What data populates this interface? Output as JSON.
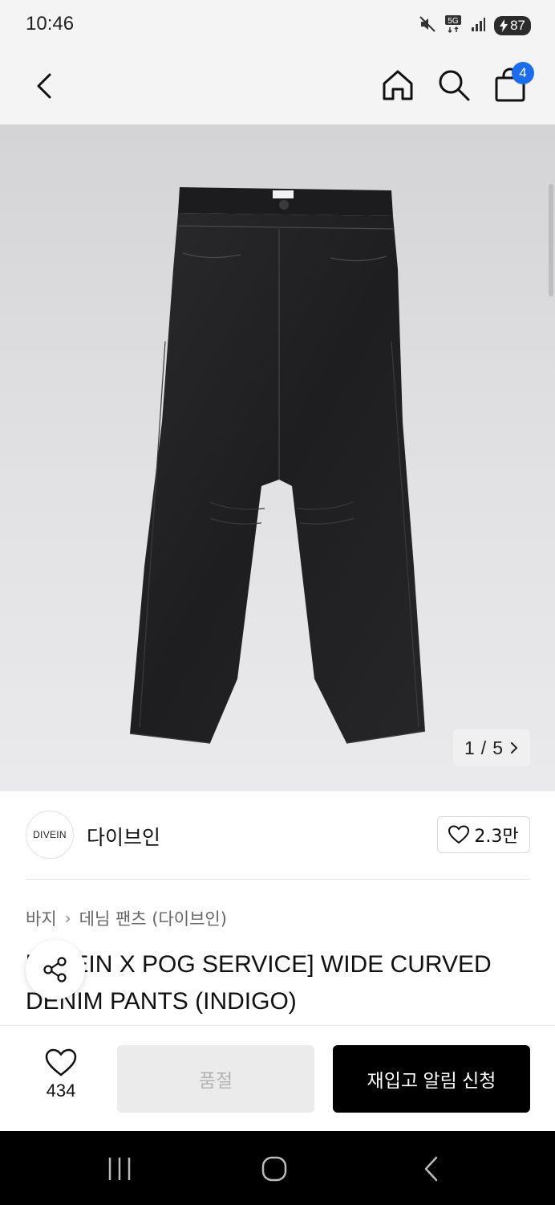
{
  "status_bar": {
    "time": "10:46",
    "battery": "87",
    "icons": [
      "mute-icon",
      "5g-icon",
      "signal-icon",
      "battery-icon"
    ]
  },
  "header": {
    "icons": [
      "back-icon",
      "home-icon",
      "search-icon",
      "bag-icon"
    ],
    "cart_count": "4"
  },
  "gallery": {
    "current": "1",
    "separator": "/",
    "total": "5"
  },
  "brand": {
    "logo_text": "DIVEIN",
    "name": "다이브인",
    "likes": "2.3만"
  },
  "breadcrumb": {
    "category": "바지",
    "subcategory": "데님 팬츠 (다이브인)"
  },
  "product": {
    "title": "[DIVEIN X POG SERVICE] WIDE CURVED DENIM PANTS (INDIGO)"
  },
  "actions": {
    "wish_count": "434",
    "soldout_label": "품절",
    "restock_label": "재입고 알림 신청"
  },
  "colors": {
    "accent": "#1a6cf0",
    "primary_button": "#000000",
    "disabled_button": "#ebebeb"
  }
}
